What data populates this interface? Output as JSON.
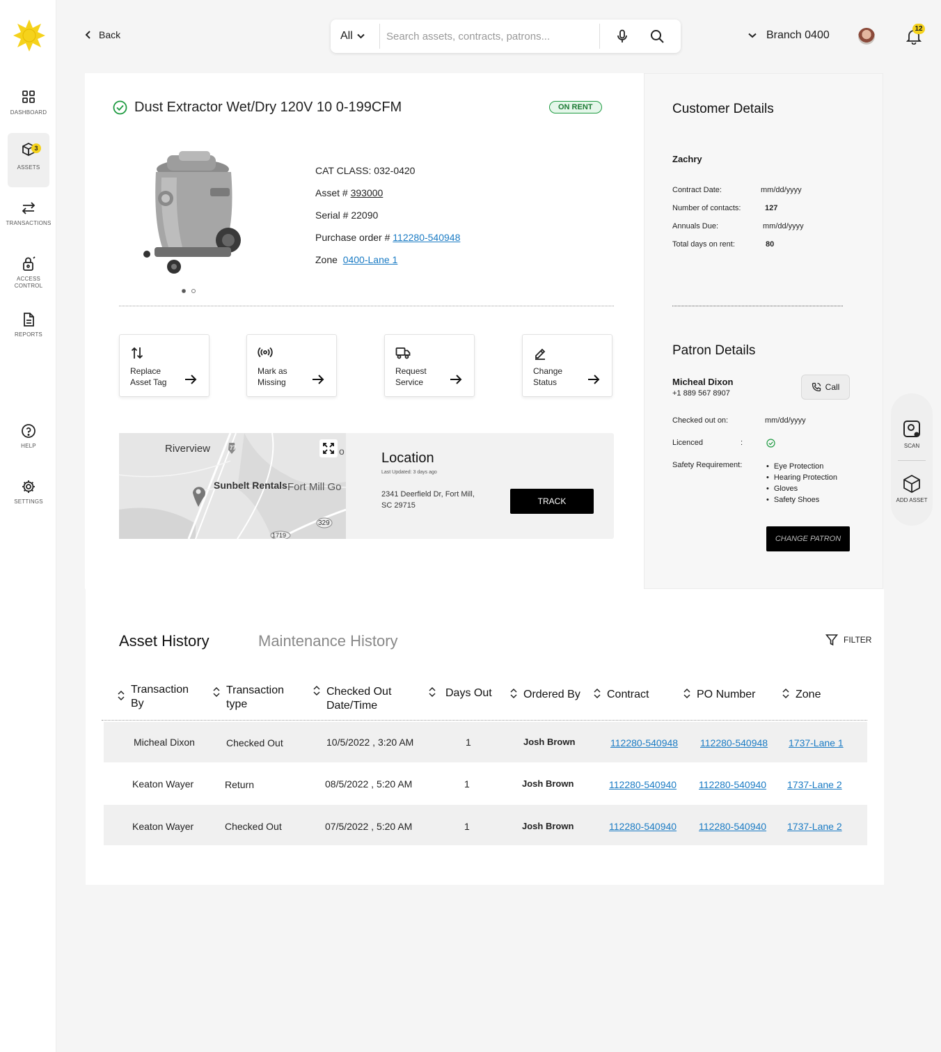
{
  "sidebar": {
    "items": [
      {
        "label": "DASHBOARD"
      },
      {
        "label": "ASSETS",
        "badge": "3"
      },
      {
        "label": "TRANSACTIONS"
      },
      {
        "label": "ACCESS CONTROL"
      },
      {
        "label": "REPORTS"
      },
      {
        "label": "HELP"
      },
      {
        "label": "SETTINGS"
      }
    ]
  },
  "header": {
    "back_label": "Back",
    "search_scope": "All",
    "search_placeholder": "Search assets, contracts, patrons...",
    "branch": "Branch 0400",
    "notification_count": "12"
  },
  "asset": {
    "title": "Dust Extractor Wet/Dry 120V 10 0-199CFM",
    "status": "ON RENT",
    "cat_class_label": "CAT CLASS:",
    "cat_class": "032-0420",
    "asset_no_label": "Asset #",
    "asset_no": "393000",
    "serial_label": "Serial #",
    "serial": "22090",
    "po_label": "Purchase order #",
    "po": "112280-540948",
    "zone_label": "Zone",
    "zone": "0400-Lane 1"
  },
  "actions": [
    {
      "label": "Replace Asset Tag"
    },
    {
      "label": "Mark as Missing"
    },
    {
      "label": "Request Service"
    },
    {
      "label": "Change Status"
    }
  ],
  "location": {
    "title": "Location",
    "updated": "Last Updated: 3 days ago",
    "address": "2341 Deerfield Dr, Fort Mill, SC 29715",
    "track_label": "TRACK",
    "map_labels": {
      "riverview": "Riverview",
      "sunbelt": "Sunbelt Rentals",
      "fortmill": "Fort Mill Go",
      "hwy77": "77",
      "hwy329": "329",
      "hwy1719": "1719",
      "edge": "o"
    }
  },
  "customer": {
    "title": "Customer Details",
    "name": "Zachry",
    "fields": [
      {
        "label": "Contract Date:",
        "value": "mm/dd/yyyy"
      },
      {
        "label": "Number of contacts:",
        "value": "127"
      },
      {
        "label": "Annuals Due:",
        "value": "mm/dd/yyyy"
      },
      {
        "label": "Total days on rent:",
        "value": "80"
      }
    ]
  },
  "patron": {
    "title": "Patron Details",
    "name": "Micheal Dixon",
    "phone": "+1 889 567 8907",
    "call_label": "Call",
    "checked_out_label": "Checked out on:",
    "checked_out_value": "mm/dd/yyyy",
    "licenced_label": "Licenced",
    "licenced_colon": ":",
    "safety_label": "Safety Requirement:",
    "safety": [
      "Eye Protection",
      "Hearing Protection",
      "Gloves",
      "Safety Shoes"
    ],
    "change_label": "CHANGE PATRON"
  },
  "float_toolbar": {
    "scan": "SCAN",
    "add_asset": "ADD ASSET"
  },
  "history": {
    "tabs": [
      "Asset History",
      "Maintenance History"
    ],
    "filter_label": "FILTER",
    "columns": [
      "Transaction By",
      "Transaction type",
      "Checked Out Date/Time",
      "Days Out",
      "Ordered By",
      "Contract",
      "PO Number",
      "Zone"
    ],
    "rows": [
      {
        "by": "Micheal Dixon",
        "type": "Checked Out",
        "date": "10/5/2022 , 3:20 AM",
        "days": "1",
        "ordered": "Josh Brown",
        "contract": "112280-540948",
        "po": "112280-540948",
        "zone": "1737-Lane 1"
      },
      {
        "by": "Keaton Wayer",
        "type": "Return",
        "date": "08/5/2022 , 5:20 AM",
        "days": "1",
        "ordered": "Josh Brown",
        "contract": "112280-540940",
        "po": "112280-540940",
        "zone": "1737-Lane 2"
      },
      {
        "by": "Keaton Wayer",
        "type": "Checked Out",
        "date": "07/5/2022 , 5:20 AM",
        "days": "1",
        "ordered": "Josh Brown",
        "contract": "112280-540940",
        "po": "112280-540940",
        "zone": "1737-Lane 2"
      }
    ]
  },
  "colors": {
    "accent": "#f5d21b",
    "link": "#1a7bc4",
    "success": "#1d9a40"
  }
}
